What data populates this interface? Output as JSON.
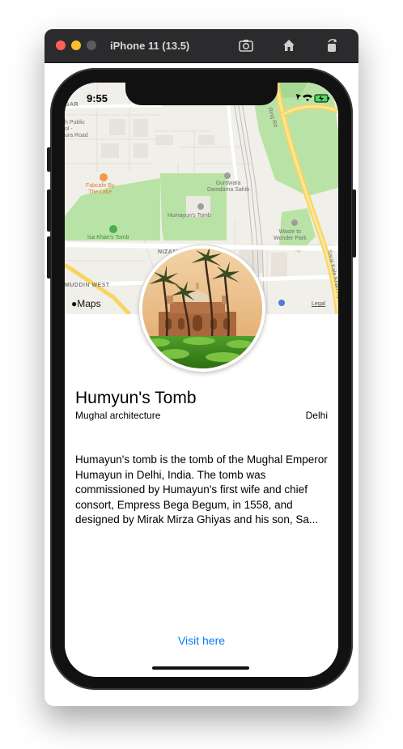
{
  "simulator": {
    "title": "iPhone 11 (13.5)",
    "toolbar_icons": [
      "screenshot-icon",
      "home-icon",
      "rotate-icon"
    ]
  },
  "status_bar": {
    "time": "9:55",
    "icons": [
      "location-arrow-icon",
      "wifi-icon",
      "battery-charging-icon"
    ]
  },
  "map": {
    "labels": {
      "public": "h Public\nol -\nura Road",
      "gar": "GAR",
      "fabcafe": "Fabcafe By\nThe Lake",
      "gurdwara": "Gurdwara\nDamdama Sahib",
      "humayun": "Humayun's Tomb",
      "isa_khan": "Isa Khan's Tomb",
      "nizamuddin": "NIZAMUDD",
      "muddin_west": "MUDDIN WEST",
      "waste": "Waste to\nWonder Park",
      "ring_rd": "Ring Rd",
      "sarai": "Sarai Kale Khan Fly"
    },
    "attribution": "Maps",
    "legal": "Legal"
  },
  "place": {
    "title": "Humyun's Tomb",
    "style": "Mughal architecture",
    "city": "Delhi",
    "description": "Humayun's tomb is the tomb of the Mughal Emperor Humayun in Delhi, India. The tomb was commissioned by Humayun's first wife and chief consort, Empress Bega Begum, in 1558, and designed by Mirak Mirza Ghiyas and his son, Sa..."
  },
  "actions": {
    "visit_label": "Visit here"
  },
  "colors": {
    "accent": "#0a7aff",
    "park_green": "#b9e3a6",
    "road_yellow": "#f7d560"
  }
}
